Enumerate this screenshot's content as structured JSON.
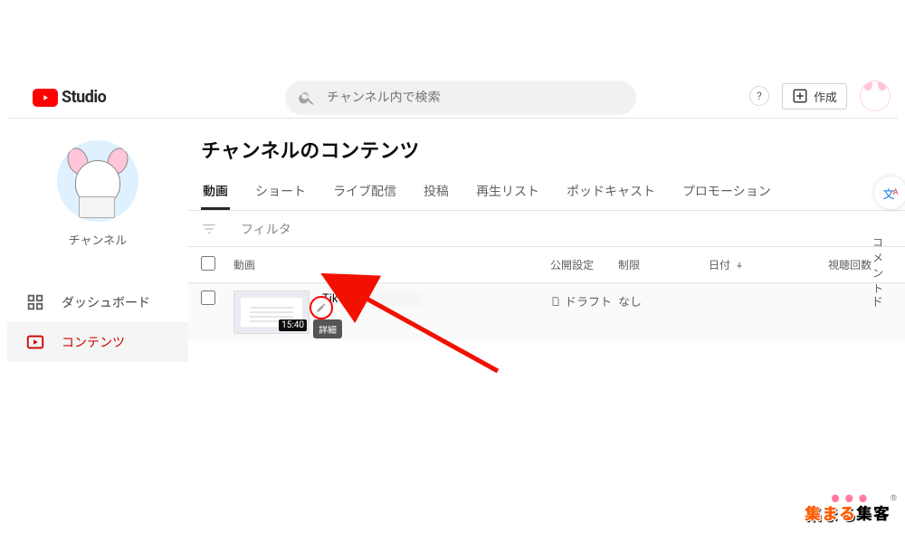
{
  "header": {
    "logo_text": "Studio",
    "search_placeholder": "チャンネル内で検索",
    "create_label": "作成"
  },
  "sidebar": {
    "channel_label": "チャンネル",
    "items": [
      {
        "label": "ダッシュボード"
      },
      {
        "label": "コンテンツ"
      }
    ]
  },
  "main": {
    "title": "チャンネルのコンテンツ",
    "tabs": [
      {
        "label": "動画",
        "active": true
      },
      {
        "label": "ショート"
      },
      {
        "label": "ライブ配信"
      },
      {
        "label": "投稿"
      },
      {
        "label": "再生リスト"
      },
      {
        "label": "ポッドキャスト"
      },
      {
        "label": "プロモーション"
      }
    ],
    "filter_label": "フィルタ",
    "columns": {
      "video": "動画",
      "visibility": "公開設定",
      "restrictions": "制限",
      "date": "日付",
      "views": "視聴回数",
      "comments": "コメント"
    },
    "rows": [
      {
        "title_prefix": "TikTok",
        "duration": "15:40",
        "detail_label": "詳細",
        "visibility": "ドラフト",
        "restrictions": "なし",
        "comments_cell": "ド"
      }
    ]
  },
  "translate_fab": {
    "main": "文",
    "sub": "A"
  },
  "watermark": {
    "a": "集まる",
    "b": "集客",
    "reg": "®"
  }
}
